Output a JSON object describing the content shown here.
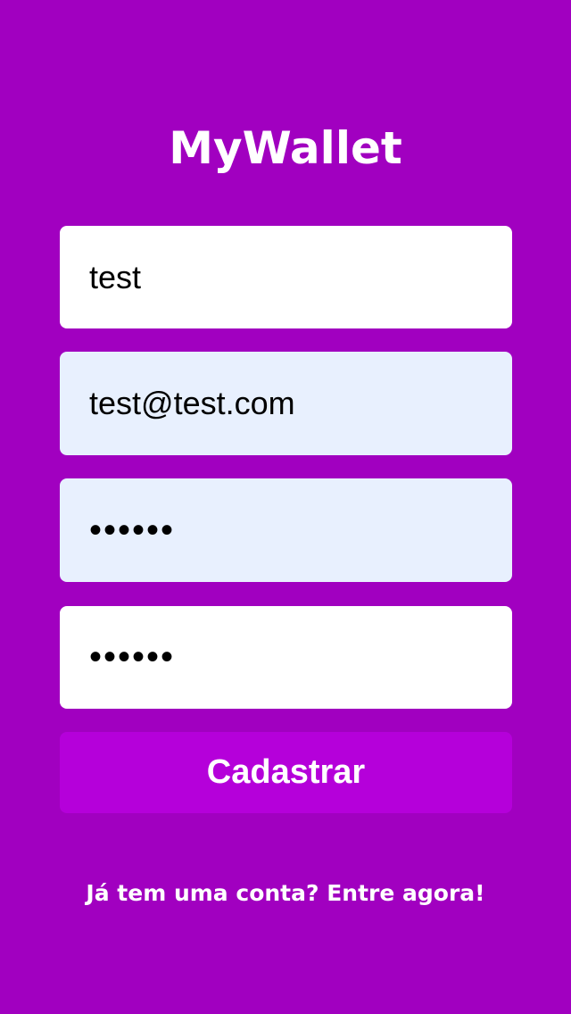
{
  "app": {
    "logo": "MyWallet"
  },
  "form": {
    "name_value": "test",
    "email_value": "test@test.com",
    "password_value": "••••••",
    "confirm_value": "••••••",
    "submit_label": "Cadastrar"
  },
  "footer": {
    "signin_link": "Já tem uma conta? Entre agora!"
  },
  "colors": {
    "background": "#A100C0",
    "button": "#B500DA",
    "field": "#FFFFFF",
    "field_autofill": "#E8F0FE",
    "text_light": "#FFFFFF"
  }
}
